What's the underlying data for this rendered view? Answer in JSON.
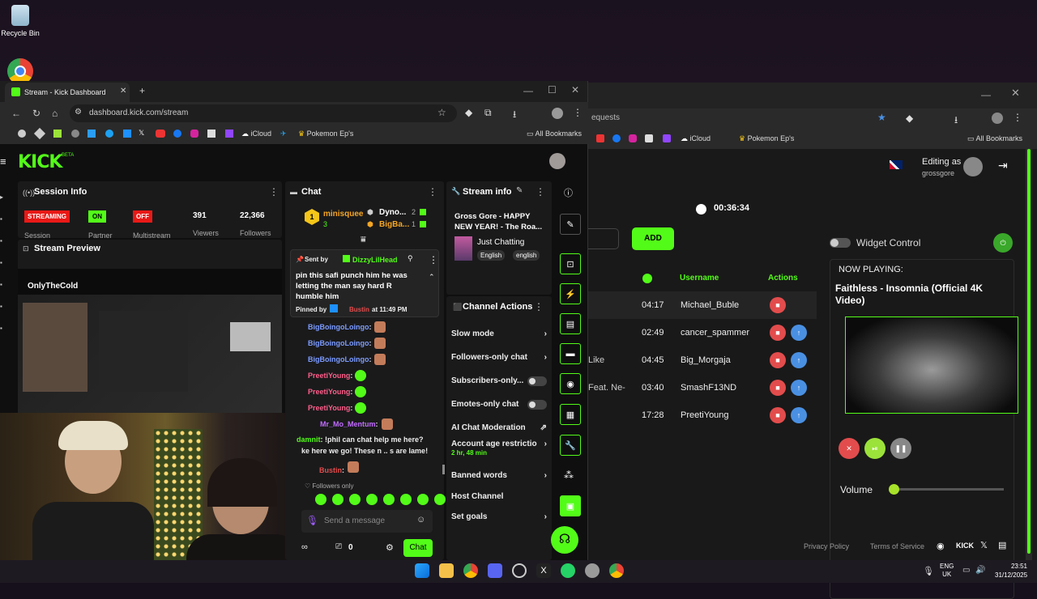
{
  "desktop": {
    "recycle_bin": "Recycle Bin"
  },
  "left_window": {
    "tab_title": "Stream - Kick Dashboard",
    "url": "dashboard.kick.com/stream",
    "bookmarks": [
      "iCloud",
      "Pokemon Ep's"
    ],
    "all_bookmarks": "All Bookmarks",
    "logo": "KICK",
    "logo_sup": "BETA",
    "session": {
      "title": "Session Info",
      "streaming": "STREAMING",
      "on": "ON",
      "off": "OFF",
      "viewers": "391",
      "followers": "22,366",
      "lbl_session": "Session",
      "lbl_partner": "Partner",
      "lbl_multistream": "Multistream",
      "lbl_viewers": "Viewers",
      "lbl_followers": "Followers"
    },
    "preview": {
      "title": "Stream Preview",
      "overlay_name": "OnlyTheCold"
    },
    "chat": {
      "title": "Chat",
      "top1": "minisquee",
      "top1_count": "3",
      "top2": "Dyno...",
      "top2_count": "2",
      "top3": "BigBa...",
      "top3_count": "1",
      "pinned_sent_by": "Sent by",
      "pinned_user": "DizzyLilHead",
      "pinned_text": "pin this safi punch him he was letting the man say hard R humble him",
      "pinned_by": "Pinned by",
      "pinned_by_user": "Bustin",
      "pinned_time": "at 11:49 PM",
      "messages": [
        {
          "user": "BigBoingoLoingo",
          "color": "#7b9bff"
        },
        {
          "user": "BigBoingoLoingo",
          "color": "#7b9bff"
        },
        {
          "user": "BigBoingoLoingo",
          "color": "#7b9bff"
        },
        {
          "user": "PreetiYoung",
          "color": "#ff5e8a"
        },
        {
          "user": "PreetiYoung",
          "color": "#ff5e8a"
        },
        {
          "user": "PreetiYoung",
          "color": "#ff5e8a"
        },
        {
          "user": "Mr_Mo_Mentum",
          "color": "#c06cff"
        }
      ],
      "msg_damnit_user": "damnit",
      "msg_damnit_text": "!phil can chat help me here?",
      "msg_cont": "ke here we go! These n .. s are lame!",
      "msg_bustin": "Bustin",
      "followers_only": "Followers only",
      "placeholder": "Send a message",
      "count0": "0",
      "send": "Chat"
    },
    "stream_info": {
      "title": "Stream info",
      "stream_title": "Gross Gore - HAPPY NEW YEAR! - The Roa...",
      "category": "Just Chatting",
      "tag1": "English",
      "tag2": "english"
    },
    "channel_actions": {
      "title": "Channel Actions",
      "slow": "Slow mode",
      "followers_only": "Followers-only chat",
      "subs_only": "Subscribers-only...",
      "emotes_only": "Emotes-only chat",
      "ai_mod": "AI Chat Moderation",
      "age": "Account age restrictio",
      "age_sub": "2 hr, 48 min",
      "banned": "Banned words",
      "host": "Host Channel",
      "goals": "Set goals"
    }
  },
  "right_window": {
    "url": "equests",
    "bookmarks": [
      "iCloud",
      "Pokemon Ep's"
    ],
    "all_bookmarks": "All Bookmarks",
    "editing_as": "Editing as",
    "editing_user": "grossgore",
    "timer": "00:36:34",
    "add": "ADD",
    "widget_control": "Widget Control",
    "now_playing": "NOW PLAYING:",
    "now_title": "Faithless - Insomnia (Official 4K Video)",
    "col_username": "Username",
    "col_actions": "Actions",
    "rows": [
      {
        "partial": "",
        "time": "04:17",
        "user": "Michael_Buble"
      },
      {
        "partial": "",
        "time": "02:49",
        "user": "cancer_spammer"
      },
      {
        "partial": "Like",
        "time": "04:45",
        "user": "Big_Morgaja"
      },
      {
        "partial": "Feat. Ne-",
        "time": "03:40",
        "user": "SmashF13ND"
      },
      {
        "partial": "",
        "time": "17:28",
        "user": "PreetiYoung"
      }
    ],
    "volume": "Volume",
    "volume_level": 0.0,
    "footer_privacy": "Privacy Policy",
    "footer_tos": "Terms of Service"
  },
  "taskbar": {
    "lang": "ENG",
    "region": "UK",
    "time": "23:51",
    "date": "31/12/2025"
  },
  "colors": {
    "kick_green": "#53fc18",
    "red": "#e91916",
    "blue": "#4a90e2"
  }
}
